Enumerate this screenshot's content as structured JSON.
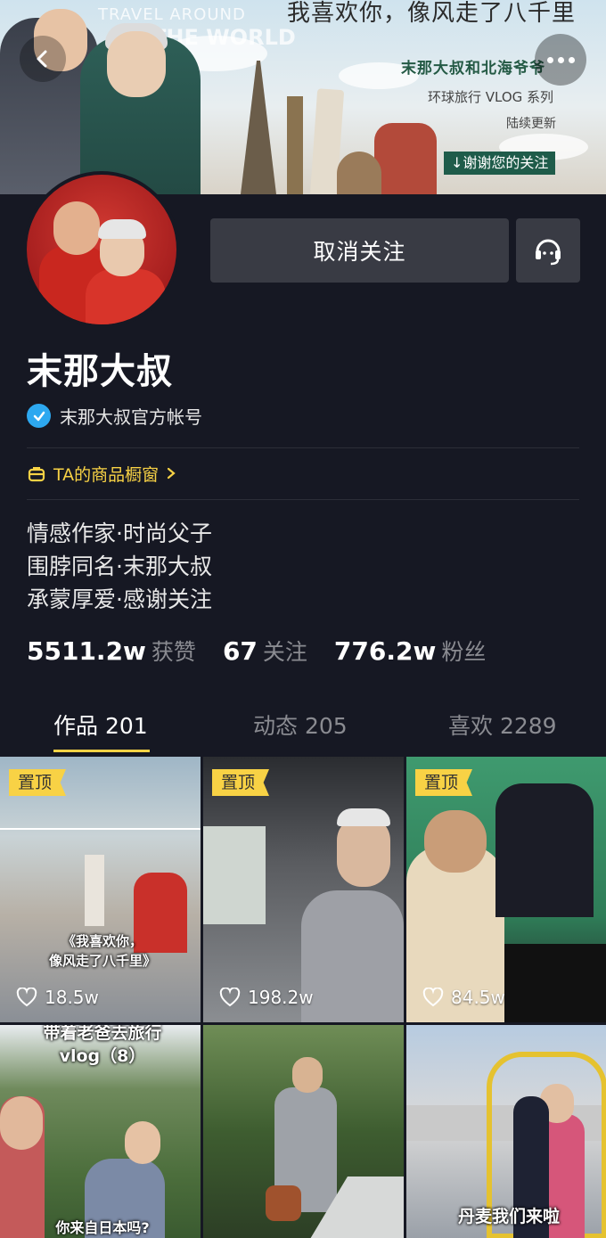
{
  "banner": {
    "travel_line1": "TRAVEL AROUND",
    "travel_line2": "THE WORLD",
    "slogan": "我喜欢你，像风走了八千里",
    "sub_title": "末那大叔和北海爷爷",
    "series": "环球旅行 VLOG 系列",
    "update": "陆续更新",
    "thanks": "谢谢您的关注"
  },
  "nav": {
    "back_icon": "chevron-left-icon",
    "more_icon": "more-dots-icon"
  },
  "profile": {
    "unfollow_label": "取消关注",
    "service_icon": "headset-icon",
    "nickname": "末那大叔",
    "verified_text": "末那大叔官方帐号",
    "shop_label": "TA的商品橱窗",
    "bio": [
      "情感作家·时尚父子",
      "围脖同名·末那大叔",
      "承蒙厚爱·感谢关注"
    ],
    "stats": {
      "likes_num": "5511.2w",
      "likes_label": "获赞",
      "following_num": "67",
      "following_label": "关注",
      "fans_num": "776.2w",
      "fans_label": "粉丝"
    }
  },
  "tabs": [
    {
      "label": "作品 201",
      "active": true
    },
    {
      "label": "动态 205",
      "active": false
    },
    {
      "label": "喜欢 2289",
      "active": false
    }
  ],
  "videos": [
    {
      "pinned": true,
      "pin_label": "置顶",
      "likes": "18.5w",
      "caption": "《我喜欢你，\n像风走了八千里》"
    },
    {
      "pinned": true,
      "pin_label": "置顶",
      "likes": "198.2w",
      "caption": ""
    },
    {
      "pinned": true,
      "pin_label": "置顶",
      "likes": "84.5w",
      "caption": ""
    },
    {
      "pinned": false,
      "pin_label": "",
      "likes": "",
      "caption": "带着老爸去旅行\nvlog（8）",
      "caption2": "你来自日本吗?"
    },
    {
      "pinned": false,
      "pin_label": "",
      "likes": "",
      "caption": ""
    },
    {
      "pinned": false,
      "pin_label": "",
      "likes": "",
      "caption": "丹麦我们来啦"
    }
  ],
  "colors": {
    "background": "#161823",
    "button": "#393b44",
    "accent_yellow": "#f8d245",
    "verified_blue": "#2da8f0"
  }
}
